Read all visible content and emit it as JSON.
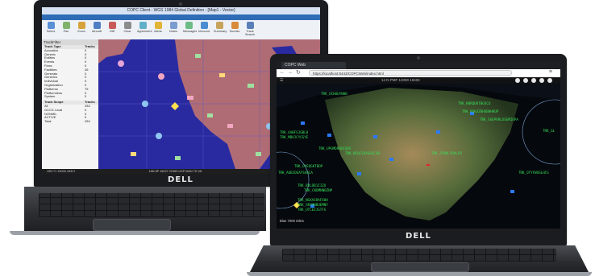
{
  "left_laptop": {
    "brand": "DELL",
    "app_title": "COPC Client - WGS 1984 Global Definition - [Map1 - Vector]",
    "ribbon_tabs": [
      "Home",
      "View",
      "Filters",
      "Tactical Alerts",
      "Comms",
      "Tools",
      "Backlight",
      "Review",
      "Collaboration",
      "Web",
      "EOB",
      "Overlays"
    ],
    "ribbon_buttons": [
      "Select",
      "Pan",
      "Zoom",
      "Aircraft",
      "Cliff",
      "Clear",
      "Agreement",
      "Alerts",
      "Notes",
      "Messages",
      "Inbound",
      "Summary",
      "Sunrise",
      "Track Search"
    ],
    "panel_title": "TrackFilter",
    "panel_columns": [
      "Track Type",
      "Tracks"
    ],
    "panel_rows": [
      {
        "name": "Acoustics",
        "value": "0"
      },
      {
        "name": "Generic",
        "value": "0"
      },
      {
        "name": "Entities",
        "value": "0"
      },
      {
        "name": "Events",
        "value": "0"
      },
      {
        "name": "Fixes",
        "value": "0"
      },
      {
        "name": "Facilities",
        "value": "36"
      },
      {
        "name": "Generals",
        "value": "0"
      },
      {
        "name": "Generics",
        "value": "0"
      },
      {
        "name": "Individual",
        "value": "0"
      },
      {
        "name": "Organization",
        "value": "0"
      },
      {
        "name": "Platforms",
        "value": "75"
      },
      {
        "name": "Platformless",
        "value": "0"
      },
      {
        "name": "System",
        "value": "0"
      }
    ],
    "panel2_columns": [
      "Track Scope",
      "Tracks"
    ],
    "panel2_rows": [
      {
        "name": "All",
        "value": "284"
      },
      {
        "name": "GCCS Local",
        "value": "0"
      },
      {
        "name": "NONMIL",
        "value": "0"
      },
      {
        "name": "ACTIVE",
        "value": "0"
      },
      {
        "name": "Total",
        "value": "284"
      }
    ],
    "status_items": [
      "19N 71 15000 43317",
      "18N 8P 16027 22360  USP MAN 75 1/8"
    ]
  },
  "right_laptop": {
    "brand": "DELL",
    "browser_tab": "COPC Web",
    "url": "https://localhost:8443/COPCWeb/index.html",
    "toolbar_coord": "14 N  PMF 12000 19402",
    "zoom_label": "Blue",
    "track_labels": [
      "TRK_OCHUUYNHB",
      "TRK_KNRQUKTBGXCO",
      "TRK_RQHJZRHXBHHKUP",
      "TRK_SXEPVRLXSGMIUPA",
      "TRK_AABFSJGBL8",
      "TRK_MBVJCYCGYE",
      "TRK_UPGMDRHXISDX",
      "TRK_NIQCSRXGHZCAB",
      "TRK_OYEQGKTBOP",
      "TRK_AUBJOEAYSXQLA",
      "TRK_ZCMHLYDVLFR",
      "TRK_OTYFWUSLHCS",
      "TRK_BVLDB1I1ZO",
      "TRK_CKDMNNBZNP",
      "TRK_NGXASRAFX0H",
      "TRK_SNYMNBUEMNY",
      "TRK_UTCEZJGTFG",
      "TRK_GL"
    ],
    "bottom_left": "Blue  7000 miles"
  },
  "colors": {
    "map_ocean_left": "#2a2aa0",
    "map_land_left": "#b06c74",
    "track_green": "#36e05a",
    "ribbon_blue": "#2e6cb6"
  }
}
